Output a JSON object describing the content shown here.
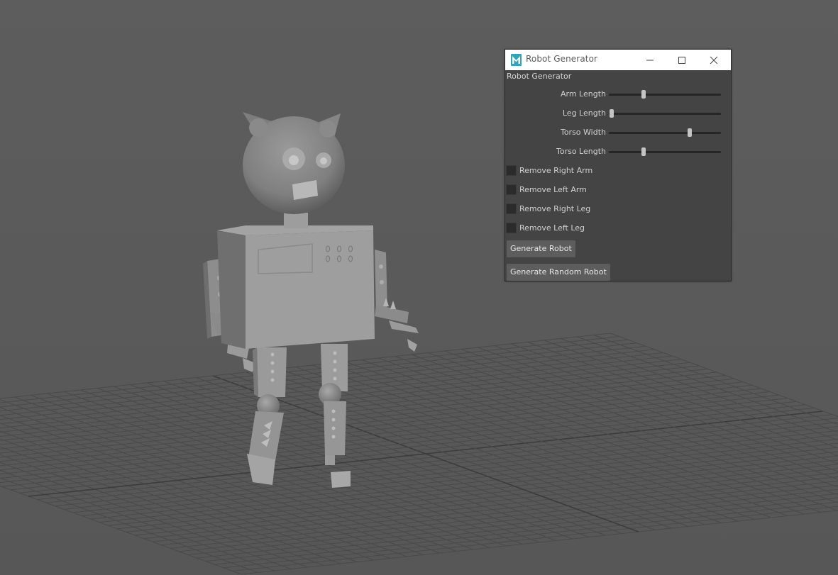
{
  "window": {
    "title": "Robot Generator",
    "icons": {
      "app": "maya-logo-icon",
      "minimize": "minimize-icon",
      "maximize": "maximize-icon",
      "close": "close-icon"
    }
  },
  "panel": {
    "title": "Robot Generator",
    "sliders": [
      {
        "label": "Arm Length",
        "value": 0.3
      },
      {
        "label": "Leg Length",
        "value": 0.0
      },
      {
        "label": "Torso Width",
        "value": 0.73
      },
      {
        "label": "Torso Length",
        "value": 0.3
      }
    ],
    "checkboxes": [
      {
        "label": "Remove Right Arm",
        "checked": false
      },
      {
        "label": "Remove Left Arm",
        "checked": false
      },
      {
        "label": "Remove Right Leg",
        "checked": false
      },
      {
        "label": "Remove Left Leg",
        "checked": false
      }
    ],
    "buttons": {
      "generate": "Generate Robot",
      "generate_random": "Generate Random Robot"
    }
  },
  "colors": {
    "viewport_bg": "#5b5b5b",
    "panel_bg": "#444444",
    "logo_teal": "#2ba7b5"
  }
}
